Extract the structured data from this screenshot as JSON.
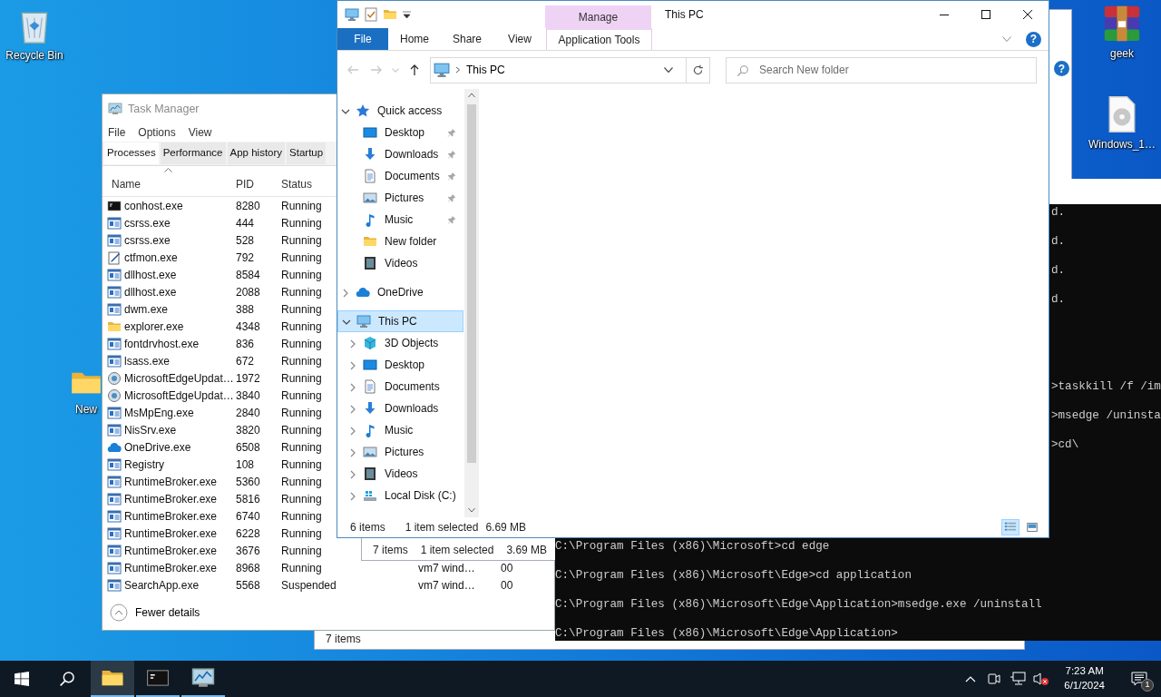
{
  "desktop_icons": [
    {
      "label": "Recycle Bin",
      "kind": "recycle-bin"
    },
    {
      "label": "New",
      "kind": "folder"
    },
    {
      "label": "geek",
      "kind": "archive"
    },
    {
      "label": "Windows_1…",
      "kind": "disc-file"
    }
  ],
  "back_window": {
    "status": "7 items"
  },
  "back_window_2": {
    "help": "?",
    "status": [
      "7 items",
      "1 item selected",
      "3.69 MB"
    ]
  },
  "task_manager": {
    "title": "Task Manager",
    "menu": [
      "File",
      "Options",
      "View"
    ],
    "tabs": [
      {
        "label": "Processes",
        "selected": true
      },
      {
        "label": "Performance",
        "selected": false
      },
      {
        "label": "App history",
        "selected": false
      },
      {
        "label": "Startup",
        "selected": false
      }
    ],
    "columns": [
      "Name",
      "PID",
      "Status"
    ],
    "rows": [
      {
        "name": "conhost.exe",
        "kind": "console",
        "pid": "8280",
        "status": "Running"
      },
      {
        "name": "csrss.exe",
        "kind": "app",
        "pid": "444",
        "status": "Running"
      },
      {
        "name": "csrss.exe",
        "kind": "app",
        "pid": "528",
        "status": "Running"
      },
      {
        "name": "ctfmon.exe",
        "kind": "pen",
        "pid": "792",
        "status": "Running"
      },
      {
        "name": "dllhost.exe",
        "kind": "app",
        "pid": "8584",
        "status": "Running"
      },
      {
        "name": "dllhost.exe",
        "kind": "app",
        "pid": "2088",
        "status": "Running"
      },
      {
        "name": "dwm.exe",
        "kind": "app",
        "pid": "388",
        "status": "Running"
      },
      {
        "name": "explorer.exe",
        "kind": "folder",
        "pid": "4348",
        "status": "Running"
      },
      {
        "name": "fontdrvhost.exe",
        "kind": "app",
        "pid": "836",
        "status": "Running"
      },
      {
        "name": "lsass.exe",
        "kind": "app",
        "pid": "672",
        "status": "Running"
      },
      {
        "name": "MicrosoftEdgeUpdat…",
        "kind": "updater",
        "pid": "1972",
        "status": "Running"
      },
      {
        "name": "MicrosoftEdgeUpdat…",
        "kind": "updater",
        "pid": "3840",
        "status": "Running"
      },
      {
        "name": "MsMpEng.exe",
        "kind": "app",
        "pid": "2840",
        "status": "Running"
      },
      {
        "name": "NisSrv.exe",
        "kind": "app",
        "pid": "3820",
        "status": "Running"
      },
      {
        "name": "OneDrive.exe",
        "kind": "cloud",
        "pid": "6508",
        "status": "Running"
      },
      {
        "name": "Registry",
        "kind": "app",
        "pid": "108",
        "status": "Running"
      },
      {
        "name": "RuntimeBroker.exe",
        "kind": "app",
        "pid": "5360",
        "status": "Running"
      },
      {
        "name": "RuntimeBroker.exe",
        "kind": "app",
        "pid": "5816",
        "status": "Running"
      },
      {
        "name": "RuntimeBroker.exe",
        "kind": "app",
        "pid": "6740",
        "status": "Running"
      },
      {
        "name": "RuntimeBroker.exe",
        "kind": "app",
        "pid": "6228",
        "status": "Running"
      },
      {
        "name": "RuntimeBroker.exe",
        "kind": "app",
        "pid": "3676",
        "status": "Running"
      },
      {
        "name": "RuntimeBroker.exe",
        "kind": "app",
        "pid": "8968",
        "status": "Running",
        "column_4": "vm7 wind…",
        "column_5": "00"
      },
      {
        "name": "SearchApp.exe",
        "kind": "app",
        "pid": "5568",
        "status": "Suspended",
        "column_4": "vm7 wind…",
        "column_5": "00"
      }
    ],
    "footer": "Fewer details"
  },
  "command_prompt": {
    "lines": [
      {
        "text": "d.",
        "cut": true,
        "kind": "output"
      },
      {
        "text": "d.",
        "cut": true,
        "kind": "output"
      },
      {
        "text": "d.",
        "cut": true,
        "kind": "output"
      },
      {
        "text": "d.",
        "cut": true,
        "kind": "output"
      },
      {
        "text": ">taskkill /f /im",
        "cut": true,
        "kind": "command"
      },
      {
        "text": ">msedge /uninsta",
        "cut": true,
        "kind": "command"
      },
      {
        "text": ">cd\\",
        "cut": true,
        "kind": "command"
      },
      {
        "text": "C:\\Program Files (x86)\\Microsoft>cd edge",
        "cut": false,
        "kind": "command"
      },
      {
        "text": "C:\\Program Files (x86)\\Microsoft\\Edge>cd application",
        "cut": false,
        "kind": "command"
      },
      {
        "text": "C:\\Program Files (x86)\\Microsoft\\Edge\\Application>msedge.exe /uninstall",
        "cut": false,
        "kind": "command"
      },
      {
        "text": "C:\\Program Files (x86)\\Microsoft\\Edge\\Application>",
        "cut": false,
        "kind": "command"
      }
    ]
  },
  "explorer": {
    "title": "This PC",
    "context_header": "Manage",
    "help": "?",
    "ribbon_tabs": [
      {
        "label": "File",
        "kind": "file"
      },
      {
        "label": "Home",
        "kind": "tab"
      },
      {
        "label": "Share",
        "kind": "tab"
      },
      {
        "label": "View",
        "kind": "tab"
      },
      {
        "label": "Application Tools",
        "kind": "context"
      }
    ],
    "nav_buttons": [
      {
        "kind": "back",
        "disabled": true
      },
      {
        "kind": "forward",
        "disabled": true
      },
      {
        "kind": "recent",
        "disabled": true
      },
      {
        "kind": "up",
        "disabled": false
      }
    ],
    "address": "This PC",
    "search": {
      "placeholder": "Search New folder"
    },
    "nav": [
      {
        "label": "Quick access",
        "kind": "star",
        "expanded": true,
        "selected": false,
        "children": [
          {
            "label": "Desktop",
            "kind": "desktop",
            "pinned": true,
            "selected": false
          },
          {
            "label": "Downloads",
            "kind": "download",
            "pinned": true,
            "selected": false
          },
          {
            "label": "Documents",
            "kind": "document",
            "pinned": true,
            "selected": false
          },
          {
            "label": "Pictures",
            "kind": "picture",
            "pinned": true,
            "selected": false
          },
          {
            "label": "Music",
            "kind": "music",
            "pinned": true,
            "selected": false
          },
          {
            "label": "New folder",
            "kind": "folder",
            "pinned": false,
            "selected": false
          },
          {
            "label": "Videos",
            "kind": "video",
            "pinned": false,
            "selected": false
          }
        ]
      },
      {
        "label": "OneDrive",
        "kind": "cloud",
        "expanded": false,
        "selected": false
      },
      {
        "label": "This PC",
        "kind": "computer",
        "expanded": true,
        "selected": true,
        "children": [
          {
            "label": "3D Objects",
            "kind": "cube",
            "expanded": false,
            "selected": false
          },
          {
            "label": "Desktop",
            "kind": "desktop",
            "expanded": false,
            "selected": false
          },
          {
            "label": "Documents",
            "kind": "document",
            "expanded": false,
            "selected": false
          },
          {
            "label": "Downloads",
            "kind": "download",
            "expanded": false,
            "selected": false
          },
          {
            "label": "Music",
            "kind": "music",
            "expanded": false,
            "selected": false
          },
          {
            "label": "Pictures",
            "kind": "picture",
            "expanded": false,
            "selected": false
          },
          {
            "label": "Videos",
            "kind": "video",
            "expanded": false,
            "selected": false
          },
          {
            "label": "Local Disk (C:)",
            "kind": "drive",
            "expanded": false,
            "selected": false
          }
        ]
      }
    ],
    "status": {
      "items": "6 items",
      "selection": "1 item selected",
      "size": "6.69 MB"
    },
    "views": [
      {
        "kind": "details",
        "selected": true
      },
      {
        "kind": "large-icons",
        "selected": false
      }
    ]
  },
  "taskbar": {
    "apps": [
      {
        "kind": "folder",
        "active": true
      },
      {
        "kind": "console",
        "active": false
      },
      {
        "kind": "task-manager",
        "active": false
      }
    ],
    "volume_muted": true,
    "time": "7:23 AM",
    "date": "6/1/2024",
    "notification_count": "1"
  }
}
